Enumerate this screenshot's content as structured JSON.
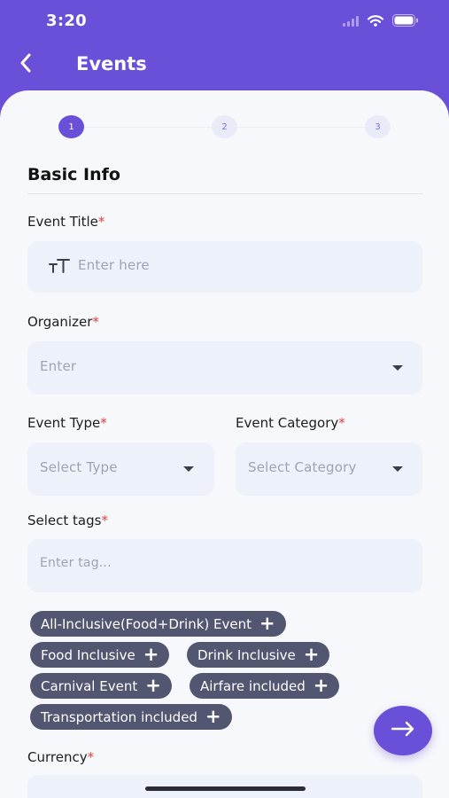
{
  "status": {
    "time": "3:20"
  },
  "header": {
    "title": "Events",
    "back_icon": "chevron-left-icon"
  },
  "stepper": {
    "steps": [
      "1",
      "2",
      "3"
    ],
    "active_index": 0
  },
  "form": {
    "section_title": "Basic Info",
    "required_mark": "*",
    "event_title": {
      "label": "Event Title",
      "placeholder": "Enter here",
      "icon": "text-size-icon"
    },
    "organizer": {
      "label": "Organizer",
      "placeholder": "Enter"
    },
    "event_type": {
      "label": "Event Type",
      "placeholder": "Select Type"
    },
    "event_category": {
      "label": "Event Category",
      "placeholder": "Select Category"
    },
    "tags": {
      "label": "Select tags",
      "placeholder": "Enter tag...",
      "suggestions": [
        "All-Inclusive(Food+Drink) Event",
        "Food Inclusive",
        "Drink Inclusive",
        "Carnival Event",
        "Airfare included",
        "Transportation included"
      ],
      "add_symbol": "+"
    },
    "currency": {
      "label": "Currency"
    }
  },
  "next_button": {
    "icon": "arrow-right-icon"
  },
  "colors": {
    "primary": "#6a4fd8",
    "chip": "#525670",
    "field": "#edf1f9",
    "required": "#e0413b"
  }
}
